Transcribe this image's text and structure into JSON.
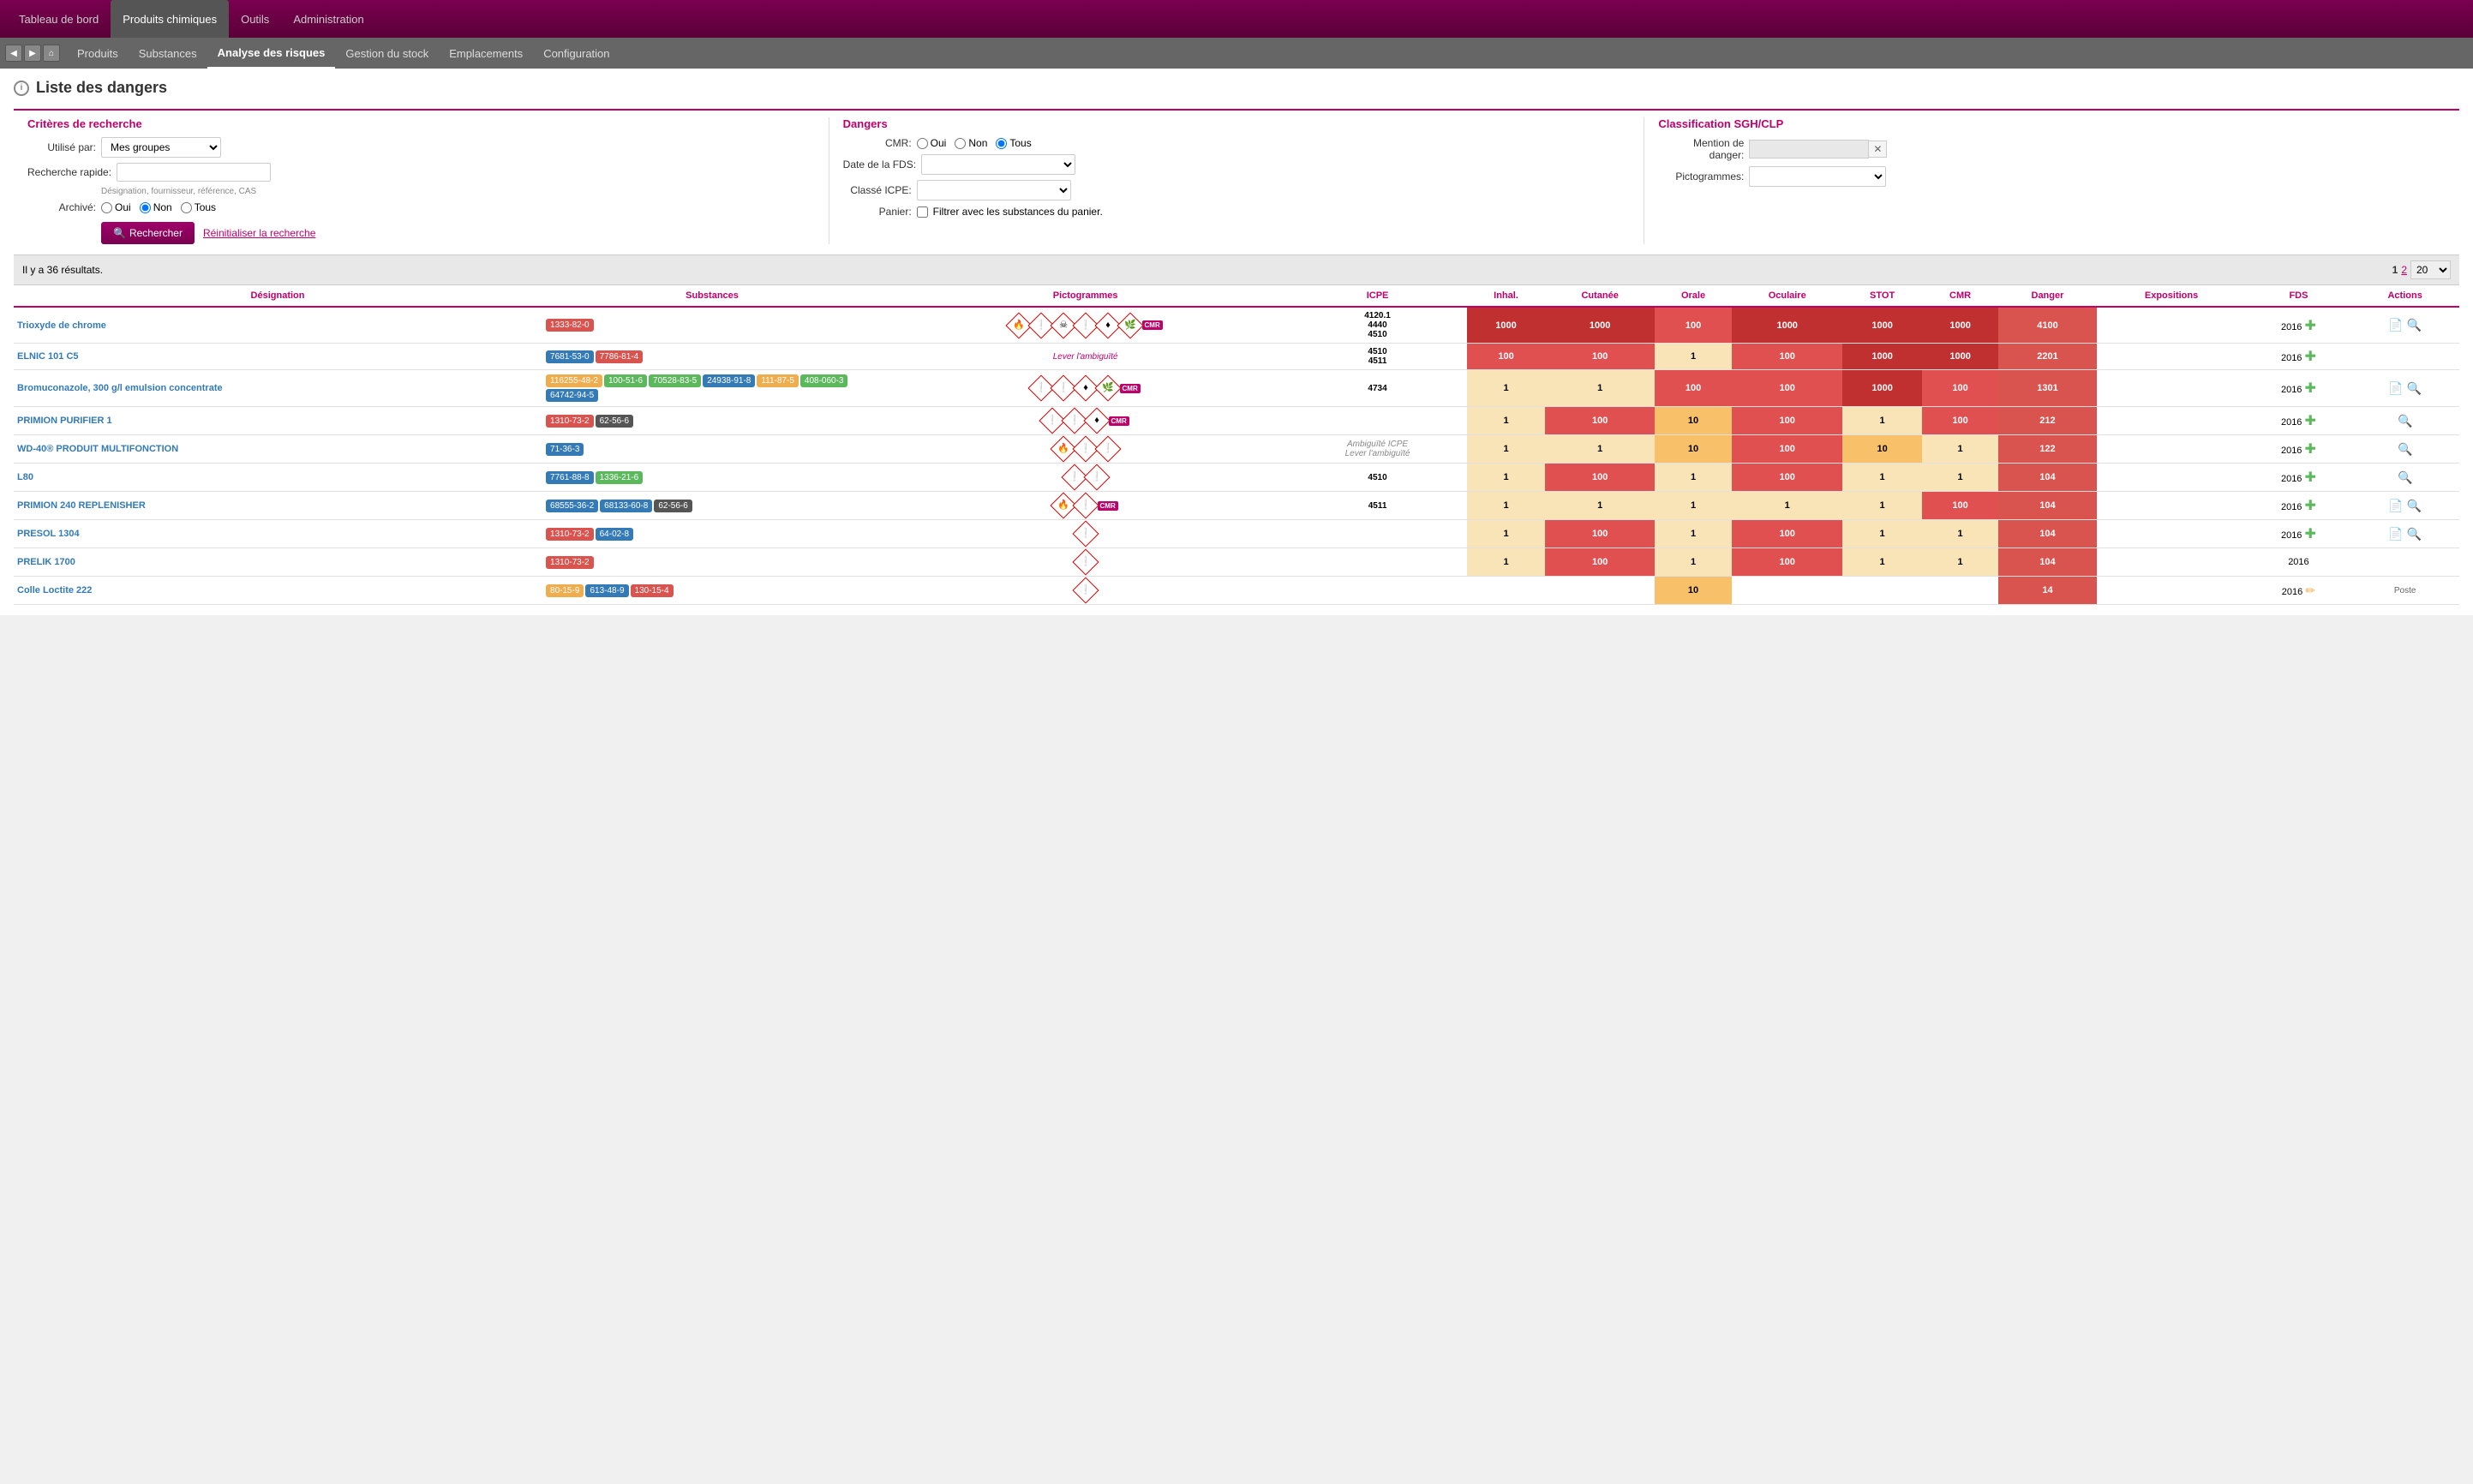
{
  "topNav": {
    "items": [
      {
        "label": "Tableau de bord",
        "active": false
      },
      {
        "label": "Produits chimiques",
        "active": true
      },
      {
        "label": "Outils",
        "active": false
      },
      {
        "label": "Administration",
        "active": false
      }
    ]
  },
  "secondNav": {
    "items": [
      {
        "label": "Produits",
        "active": false
      },
      {
        "label": "Substances",
        "active": false
      },
      {
        "label": "Analyse des risques",
        "active": true
      },
      {
        "label": "Gestion du stock",
        "active": false
      },
      {
        "label": "Emplacements",
        "active": false
      },
      {
        "label": "Configuration",
        "active": false
      }
    ]
  },
  "page": {
    "title": "Liste des dangers"
  },
  "criteresSection": {
    "title": "Critères de recherche",
    "utiliseParLabel": "Utilisé par:",
    "utiliseParValue": "Mes groupes",
    "rechercheRapideLabel": "Recherche rapide:",
    "rechercheRapidePlaceholder": "",
    "hint": "Désignation, fournisseur, référence, CAS",
    "archiveLabel": "Archivé:",
    "archiveOptions": [
      "Oui",
      "Non",
      "Tous"
    ],
    "archiveSelected": "Non",
    "btnSearch": "Rechercher",
    "btnReset": "Réinitialiser la recherche"
  },
  "dangersSection": {
    "title": "Dangers",
    "cmrLabel": "CMR:",
    "cmrOptions": [
      "Oui",
      "Non",
      "Tous"
    ],
    "cmrSelected": "Tous",
    "dateFdsLabel": "Date de la FDS:",
    "classeIcpeLabel": "Classé ICPE:",
    "panierLabel": "Panier:",
    "panierCheckbox": false,
    "panierText": "Filtrer avec les substances du panier."
  },
  "classifSection": {
    "title": "Classification SGH/CLP",
    "mentionLabel": "Mention de",
    "mentionLabel2": "danger:",
    "pictogrammesLabel": "Pictogrammes:"
  },
  "results": {
    "countText": "Il y a 36 résultats.",
    "pages": [
      "1",
      "2"
    ],
    "currentPage": "1",
    "perPage": "20"
  },
  "tableHeaders": [
    "Désignation",
    "Substances",
    "Pictogrammes",
    "ICPE",
    "Inhal.",
    "Cutanée",
    "Orale",
    "Oculaire",
    "STOT",
    "CMR",
    "Danger",
    "Expositions",
    "FDS",
    "Actions"
  ],
  "rows": [
    {
      "designation": "Trioxyde de chrome",
      "substances": [
        {
          "label": "1333-82-0",
          "color": "red"
        }
      ],
      "pictograms": [
        "flame",
        "excl",
        "skull",
        "exclam",
        "health",
        "environ",
        "cmr"
      ],
      "icpe": "4120.1\n4440\n4510",
      "inhal": "1000",
      "inhalColor": 4,
      "cutanee": "1000",
      "cutaneeColor": 4,
      "orale": "100",
      "oraleColor": 3,
      "oculaire": "1000",
      "oculaireColor": 4,
      "stot": "1000",
      "stotColor": 4,
      "cmr": "1000",
      "cmrColor": 4,
      "danger": "4100",
      "expositions": "",
      "fds": "2016",
      "hasFds": true,
      "hasAdd": true,
      "hasSearch": true
    },
    {
      "designation": "ELNIC 101 C5",
      "substances": [
        {
          "label": "7681-53-0",
          "color": "blue"
        },
        {
          "label": "7786-81-4",
          "color": "red"
        }
      ],
      "pictograms": [],
      "pictoText": "Lever l'ambiguïté",
      "icpe": "4510\n4511",
      "inhal": "100",
      "inhalColor": 3,
      "cutanee": "100",
      "cutaneeColor": 3,
      "orale": "1",
      "oraleColor": 1,
      "oculaire": "100",
      "oculaireColor": 3,
      "stot": "1000",
      "stotColor": 4,
      "cmr": "1000",
      "cmrColor": 4,
      "danger": "2201",
      "expositions": "",
      "fds": "2016",
      "hasFds": false,
      "hasAdd": true,
      "hasSearch": false
    },
    {
      "designation": "Bromuconazole, 300 g/l emulsion concentrate",
      "substances": [
        {
          "label": "116255-48-2",
          "color": "orange"
        },
        {
          "label": "100-51-6",
          "color": "green"
        },
        {
          "label": "70528-83-5",
          "color": "green"
        },
        {
          "label": "24938-91-8",
          "color": "blue"
        },
        {
          "label": "111-87-5",
          "color": "orange"
        },
        {
          "label": "408-060-3",
          "color": "green"
        },
        {
          "label": "64742-94-5",
          "color": "blue"
        }
      ],
      "pictograms": [
        "exclam2",
        "exclaim2",
        "health2",
        "environ2",
        "cmr2"
      ],
      "icpe": "4734",
      "inhal": "1",
      "inhalColor": 1,
      "cutanee": "1",
      "cutaneeColor": 1,
      "orale": "100",
      "oraleColor": 3,
      "oculaire": "100",
      "oculaireColor": 3,
      "stot": "1000",
      "stotColor": 4,
      "cmr": "100",
      "cmrColor": 3,
      "danger": "1301",
      "expositions": "",
      "fds": "2016",
      "hasFds": true,
      "hasAdd": true,
      "hasSearch": true
    },
    {
      "designation": "PRIMION PURIFIER 1",
      "substances": [
        {
          "label": "1310-73-2",
          "color": "red"
        },
        {
          "label": "62-56-6",
          "color": "dark"
        }
      ],
      "pictograms": [
        "exclam3",
        "exclaim3",
        "health3",
        "cmr3"
      ],
      "icpe": "",
      "inhal": "1",
      "inhalColor": 1,
      "cutanee": "100",
      "cutaneeColor": 3,
      "orale": "10",
      "oraleColor": 2,
      "oculaire": "100",
      "oculaireColor": 3,
      "stot": "1",
      "stotColor": 1,
      "cmr": "100",
      "cmrColor": 3,
      "danger": "212",
      "expositions": "",
      "fds": "2016",
      "hasFds": false,
      "hasAdd": true,
      "hasSearch": true
    },
    {
      "designation": "WD-40® PRODUIT MULTIFONCTION",
      "substances": [
        {
          "label": "71-36-3",
          "color": "blue"
        }
      ],
      "pictograms": [
        "flame2",
        "exclam4",
        "exclaim4"
      ],
      "icpe": "Ambiguïté ICPE\nLever l'ambiguïté",
      "icpeItalic": true,
      "inhal": "1",
      "inhalColor": 1,
      "cutanee": "1",
      "cutaneeColor": 1,
      "orale": "10",
      "oraleColor": 2,
      "oculaire": "100",
      "oculaireColor": 3,
      "stot": "10",
      "stotColor": 2,
      "cmr": "1",
      "cmrColor": 1,
      "danger": "122",
      "expositions": "",
      "fds": "2016",
      "hasFds": false,
      "hasAdd": true,
      "hasSearch": true
    },
    {
      "designation": "L80",
      "substances": [
        {
          "label": "7761-88-8",
          "color": "blue"
        },
        {
          "label": "1336-21-6",
          "color": "green"
        }
      ],
      "pictograms": [
        "exclam5",
        "exclam6"
      ],
      "icpe": "4510",
      "inhal": "1",
      "inhalColor": 1,
      "cutanee": "100",
      "cutaneeColor": 3,
      "orale": "1",
      "oraleColor": 1,
      "oculaire": "100",
      "oculaireColor": 3,
      "stot": "1",
      "stotColor": 1,
      "cmr": "1",
      "cmrColor": 1,
      "danger": "104",
      "expositions": "",
      "fds": "2016",
      "hasFds": false,
      "hasAdd": true,
      "hasSearch": true
    },
    {
      "designation": "PRIMION 240 REPLENISHER",
      "substances": [
        {
          "label": "68555-36-2",
          "color": "blue"
        },
        {
          "label": "68133-60-8",
          "color": "blue"
        },
        {
          "label": "62-56-6",
          "color": "dark"
        }
      ],
      "pictograms": [
        "flame3",
        "exclam7",
        "cmr4"
      ],
      "icpe": "4511",
      "inhal": "1",
      "inhalColor": 1,
      "cutanee": "1",
      "cutaneeColor": 1,
      "orale": "1",
      "oraleColor": 1,
      "oculaire": "1",
      "oculaireColor": 1,
      "stot": "1",
      "stotColor": 1,
      "cmr": "100",
      "cmrColor": 3,
      "danger": "104",
      "expositions": "",
      "fds": "2016",
      "hasFds": true,
      "hasAdd": true,
      "hasSearch": true
    },
    {
      "designation": "PRESOL 1304",
      "substances": [
        {
          "label": "1310-73-2",
          "color": "red"
        },
        {
          "label": "64-02-8",
          "color": "blue"
        }
      ],
      "pictograms": [
        "exclam8"
      ],
      "icpe": "",
      "inhal": "1",
      "inhalColor": 1,
      "cutanee": "100",
      "cutaneeColor": 3,
      "orale": "1",
      "oraleColor": 1,
      "oculaire": "100",
      "oculaireColor": 3,
      "stot": "1",
      "stotColor": 1,
      "cmr": "1",
      "cmrColor": 1,
      "danger": "104",
      "expositions": "",
      "fds": "2016",
      "hasFds": true,
      "hasAdd": true,
      "hasSearch": true
    },
    {
      "designation": "PRELIK 1700",
      "substances": [
        {
          "label": "1310-73-2",
          "color": "red"
        }
      ],
      "pictograms": [
        "exclam9"
      ],
      "icpe": "",
      "inhal": "1",
      "inhalColor": 1,
      "cutanee": "100",
      "cutaneeColor": 3,
      "orale": "1",
      "oraleColor": 1,
      "oculaire": "100",
      "oculaireColor": 3,
      "stot": "1",
      "stotColor": 1,
      "cmr": "1",
      "cmrColor": 1,
      "danger": "104",
      "expositions": "",
      "fds": "2016",
      "hasFds": false,
      "hasAdd": false,
      "hasSearch": false
    },
    {
      "designation": "Colle Loctite 222",
      "substances": [
        {
          "label": "80-15-9",
          "color": "orange"
        },
        {
          "label": "613-48-9",
          "color": "blue"
        },
        {
          "label": "130-15-4",
          "color": "red"
        }
      ],
      "pictograms": [
        "exclaim5"
      ],
      "icpe": "",
      "inhal": "",
      "inhalColor": 0,
      "cutanee": "",
      "cutaneeColor": 0,
      "orale": "10",
      "oraleColor": 2,
      "oculaire": "",
      "oculaireColor": 0,
      "stot": "",
      "stotColor": 0,
      "cmr": "",
      "cmrColor": 0,
      "danger": "14",
      "expositions": "",
      "fds": "2016",
      "hasFds": false,
      "hasAdd": false,
      "hasSearch": false,
      "hasEdit": true,
      "hasPoste": true
    }
  ]
}
